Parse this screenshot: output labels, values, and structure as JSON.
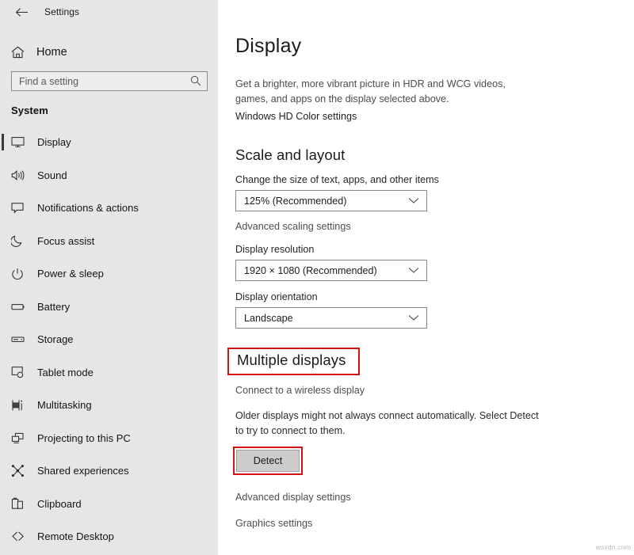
{
  "window": {
    "title": "Settings",
    "back_icon": "back-arrow-icon"
  },
  "sidebar": {
    "home": {
      "label": "Home",
      "icon": "home-icon"
    },
    "search": {
      "placeholder": "Find a setting",
      "value": "",
      "icon": "search-icon"
    },
    "group_title": "System",
    "items": [
      {
        "label": "Display",
        "icon": "monitor-icon",
        "selected": true
      },
      {
        "label": "Sound",
        "icon": "speaker-icon",
        "selected": false
      },
      {
        "label": "Notifications & actions",
        "icon": "speech-bubble-icon",
        "selected": false
      },
      {
        "label": "Focus assist",
        "icon": "moon-icon",
        "selected": false
      },
      {
        "label": "Power & sleep",
        "icon": "power-icon",
        "selected": false
      },
      {
        "label": "Battery",
        "icon": "battery-icon",
        "selected": false
      },
      {
        "label": "Storage",
        "icon": "storage-icon",
        "selected": false
      },
      {
        "label": "Tablet mode",
        "icon": "tablet-mode-icon",
        "selected": false
      },
      {
        "label": "Multitasking",
        "icon": "multitasking-icon",
        "selected": false
      },
      {
        "label": "Projecting to this PC",
        "icon": "projecting-icon",
        "selected": false
      },
      {
        "label": "Shared experiences",
        "icon": "share-nodes-icon",
        "selected": false
      },
      {
        "label": "Clipboard",
        "icon": "clipboard-icon",
        "selected": false
      },
      {
        "label": "Remote Desktop",
        "icon": "remote-desktop-icon",
        "selected": false
      }
    ]
  },
  "main": {
    "page_title": "Display",
    "hdr_description": "Get a brighter, more vibrant picture in HDR and WCG videos, games, and apps on the display selected above.",
    "hd_color_link": "Windows HD Color settings",
    "scale_section": {
      "title": "Scale and layout",
      "scale_label": "Change the size of text, apps, and other items",
      "scale_value": "125% (Recommended)",
      "advanced_scaling_link": "Advanced scaling settings",
      "resolution_label": "Display resolution",
      "resolution_value": "1920 × 1080 (Recommended)",
      "orientation_label": "Display orientation",
      "orientation_value": "Landscape"
    },
    "multiple_displays": {
      "title": "Multiple displays",
      "wireless_link": "Connect to a wireless display",
      "detect_description": "Older displays might not always connect automatically. Select Detect to try to connect to them.",
      "detect_button": "Detect"
    },
    "advanced_display_link": "Advanced display settings",
    "graphics_settings_link": "Graphics settings"
  },
  "annotations": {
    "highlight_color": "#d01212",
    "highlighted": [
      "Multiple displays",
      "Detect"
    ]
  },
  "watermark": "wsxdn.com"
}
